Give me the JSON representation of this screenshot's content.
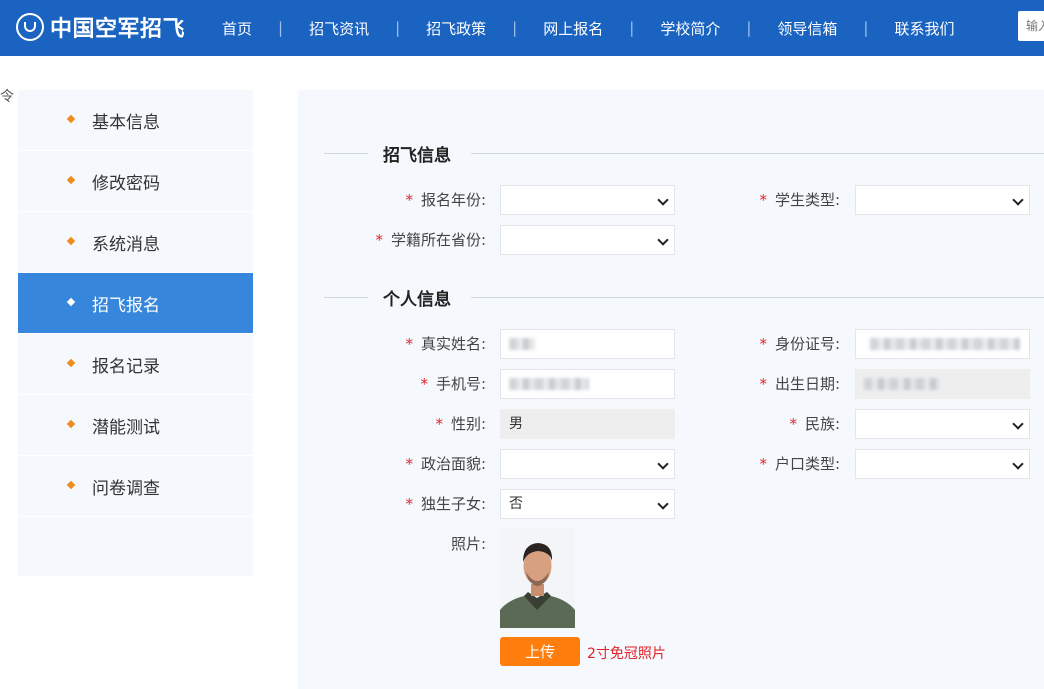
{
  "header": {
    "logo_text": "中国空军招飞",
    "nav": [
      "首页",
      "招飞资讯",
      "招飞政策",
      "网上报名",
      "学校简介",
      "领导信箱",
      "联系我们"
    ],
    "separator": "|",
    "search_placeholder": "输入"
  },
  "left_edge_glyph": "令",
  "sidebar": {
    "items": [
      {
        "label": "基本信息",
        "active": false
      },
      {
        "label": "修改密码",
        "active": false
      },
      {
        "label": "系统消息",
        "active": false
      },
      {
        "label": "招飞报名",
        "active": true
      },
      {
        "label": "报名记录",
        "active": false
      },
      {
        "label": "潜能测试",
        "active": false
      },
      {
        "label": "问卷调查",
        "active": false
      }
    ]
  },
  "form": {
    "section1_title": "招飞信息",
    "section2_title": "个人信息",
    "required_mark": "*",
    "labels": {
      "reg_year": "报名年份:",
      "student_type": "学生类型:",
      "province": "学籍所在省份:",
      "real_name": "真实姓名:",
      "id_number": "身份证号:",
      "phone": "手机号:",
      "birth_date": "出生日期:",
      "gender": "性别:",
      "ethnicity": "民族:",
      "political": "政治面貌:",
      "hukou": "户口类型:",
      "only_child": "独生子女:",
      "photo": "照片:"
    },
    "values": {
      "gender": "男",
      "only_child": "否"
    },
    "upload_label": "上传",
    "photo_hint": "2寸免冠照片"
  },
  "colors": {
    "header_bg": "#1a63c0",
    "active_item": "#3686dc",
    "bullet": "#f08c1e",
    "upload_button": "#ff7e0e",
    "required": "#e0242a"
  }
}
